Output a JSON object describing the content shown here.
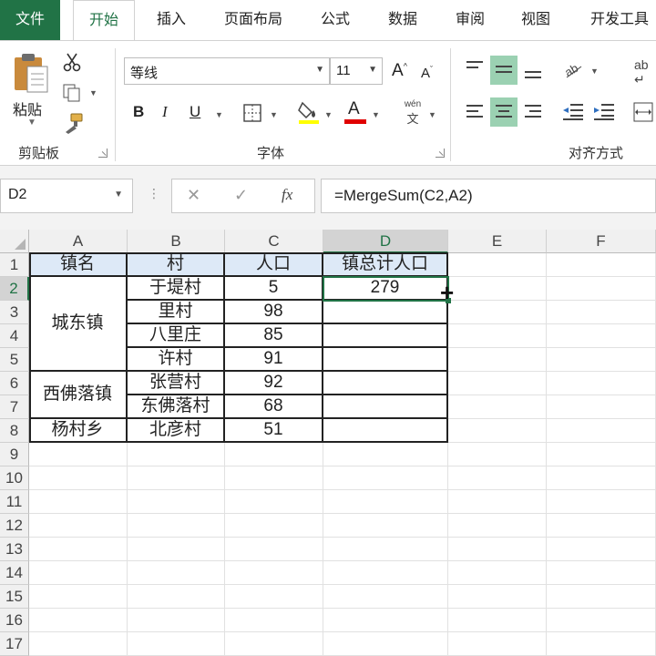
{
  "tabs": [
    "文件",
    "开始",
    "插入",
    "页面布局",
    "公式",
    "数据",
    "审阅",
    "视图",
    "开发工具"
  ],
  "clipboard": {
    "paste_label": "粘贴",
    "group_label": "剪贴板"
  },
  "font": {
    "name": "等线",
    "size": "11",
    "group_label": "字体",
    "grow_label": "A",
    "shrink_label": "A",
    "bold": "B",
    "italic": "I",
    "underline": "U",
    "font_color_letter": "A",
    "phonetic_top": "wén",
    "phonetic_bottom": "文"
  },
  "alignment": {
    "group_label": "对齐方式",
    "wrap_label": "ab"
  },
  "name_box": "D2",
  "formula_bar": {
    "formula": "=MergeSum(C2,A2)",
    "fx_label": "fx"
  },
  "grid": {
    "columns": [
      "A",
      "B",
      "C",
      "D",
      "E",
      "F"
    ],
    "rows": [
      "1",
      "2",
      "3",
      "4",
      "5",
      "6",
      "7",
      "8",
      "9",
      "10",
      "11",
      "12",
      "13",
      "14",
      "15",
      "16",
      "17"
    ],
    "header_row": [
      "镇名",
      "村",
      "人口",
      "镇总计人口"
    ],
    "towns": [
      {
        "name": "城东镇",
        "villages": [
          "于堤村",
          "里村",
          "八里庄",
          "许村"
        ],
        "population": [
          "5",
          "98",
          "85",
          "91"
        ]
      },
      {
        "name": "西佛落镇",
        "villages": [
          "张营村",
          "东佛落村"
        ],
        "population": [
          "92",
          "68"
        ]
      },
      {
        "name": "杨村乡",
        "villages": [
          "北彦村"
        ],
        "population": [
          "51"
        ]
      }
    ],
    "d2_value": "279"
  },
  "colors": {
    "accent": "#217346",
    "header_fill": "#dde9f7",
    "align_selected": "#9bd1b2"
  }
}
